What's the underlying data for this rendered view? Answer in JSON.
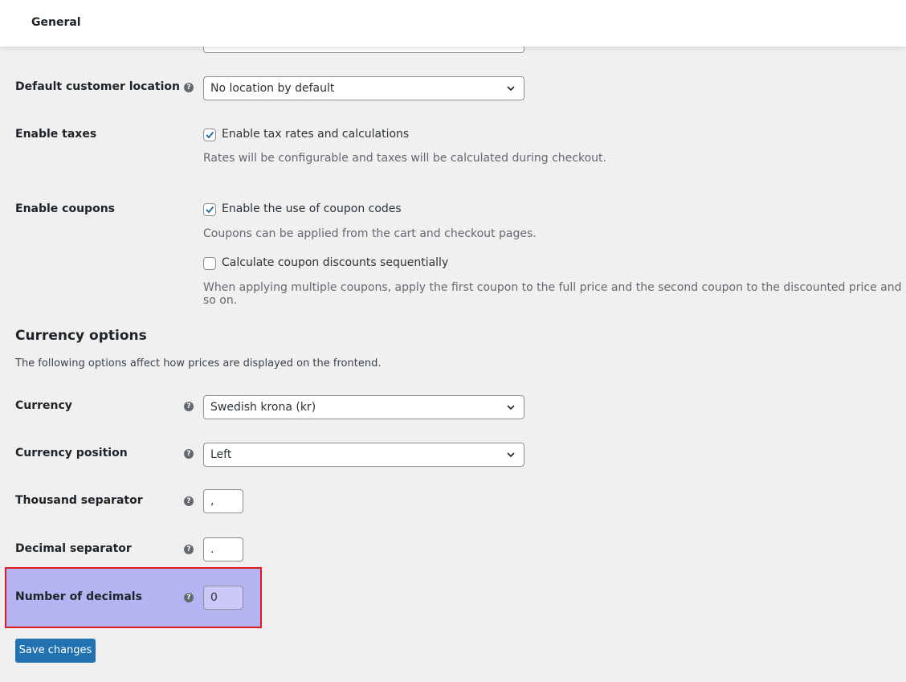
{
  "header": {
    "title": "General"
  },
  "fields": {
    "default_location": {
      "label": "Default customer location",
      "value": "No location by default"
    },
    "taxes": {
      "label": "Enable taxes",
      "checkbox_label": "Enable tax rates and calculations",
      "checked": true,
      "description": "Rates will be configurable and taxes will be calculated during checkout."
    },
    "coupons": {
      "label": "Enable coupons",
      "checkbox_label": "Enable the use of coupon codes",
      "checked": true,
      "description": "Coupons can be applied from the cart and checkout pages.",
      "sequential_label": "Calculate coupon discounts sequentially",
      "sequential_checked": false,
      "sequential_description": "When applying multiple coupons, apply the first coupon to the full price and the second coupon to the discounted price and so on."
    }
  },
  "currency_section": {
    "title": "Currency options",
    "description": "The following options affect how prices are displayed on the frontend.",
    "currency": {
      "label": "Currency",
      "value": "Swedish krona (kr)"
    },
    "position": {
      "label": "Currency position",
      "value": "Left"
    },
    "thousand_sep": {
      "label": "Thousand separator",
      "value": ","
    },
    "decimal_sep": {
      "label": "Decimal separator",
      "value": "."
    },
    "decimals": {
      "label": "Number of decimals",
      "value": "0"
    }
  },
  "help_glyph": "?",
  "save_button": {
    "label": "Save changes"
  },
  "colors": {
    "accent": "#2271b1",
    "highlight_fill": "#b5b4f3",
    "highlight_border": "#e01b24",
    "checkmark": "#2271b1"
  }
}
